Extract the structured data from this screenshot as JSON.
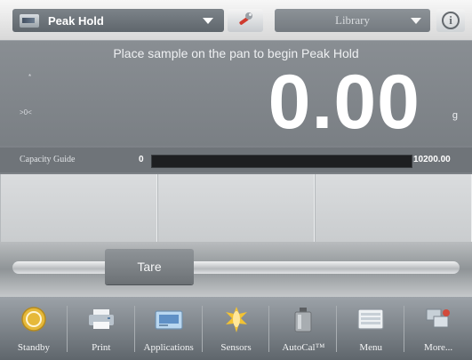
{
  "topbar": {
    "application": "Peak Hold",
    "library": "Library",
    "icons": {
      "application": "application-icon",
      "tool": "wrench-icon",
      "info": "info-icon"
    }
  },
  "display": {
    "message": "Place sample on the pan to begin Peak Hold",
    "indicator_top": "*",
    "indicator_zero": ">0<",
    "weight": "0.00",
    "unit": "g"
  },
  "capacity": {
    "label": "Capacity Guide",
    "min": "0",
    "max": "10200.00",
    "fill_fraction": 0.0
  },
  "tare": {
    "label": "Tare"
  },
  "nav": {
    "items": [
      {
        "label": "Standby",
        "icon": "standby-icon"
      },
      {
        "label": "Print",
        "icon": "printer-icon"
      },
      {
        "label": "Applications",
        "icon": "applications-icon"
      },
      {
        "label": "Sensors",
        "icon": "sensors-icon"
      },
      {
        "label": "AutoCal™",
        "icon": "autocal-icon"
      },
      {
        "label": "Menu",
        "icon": "menu-icon"
      },
      {
        "label": "More...",
        "icon": "more-icon"
      }
    ]
  }
}
